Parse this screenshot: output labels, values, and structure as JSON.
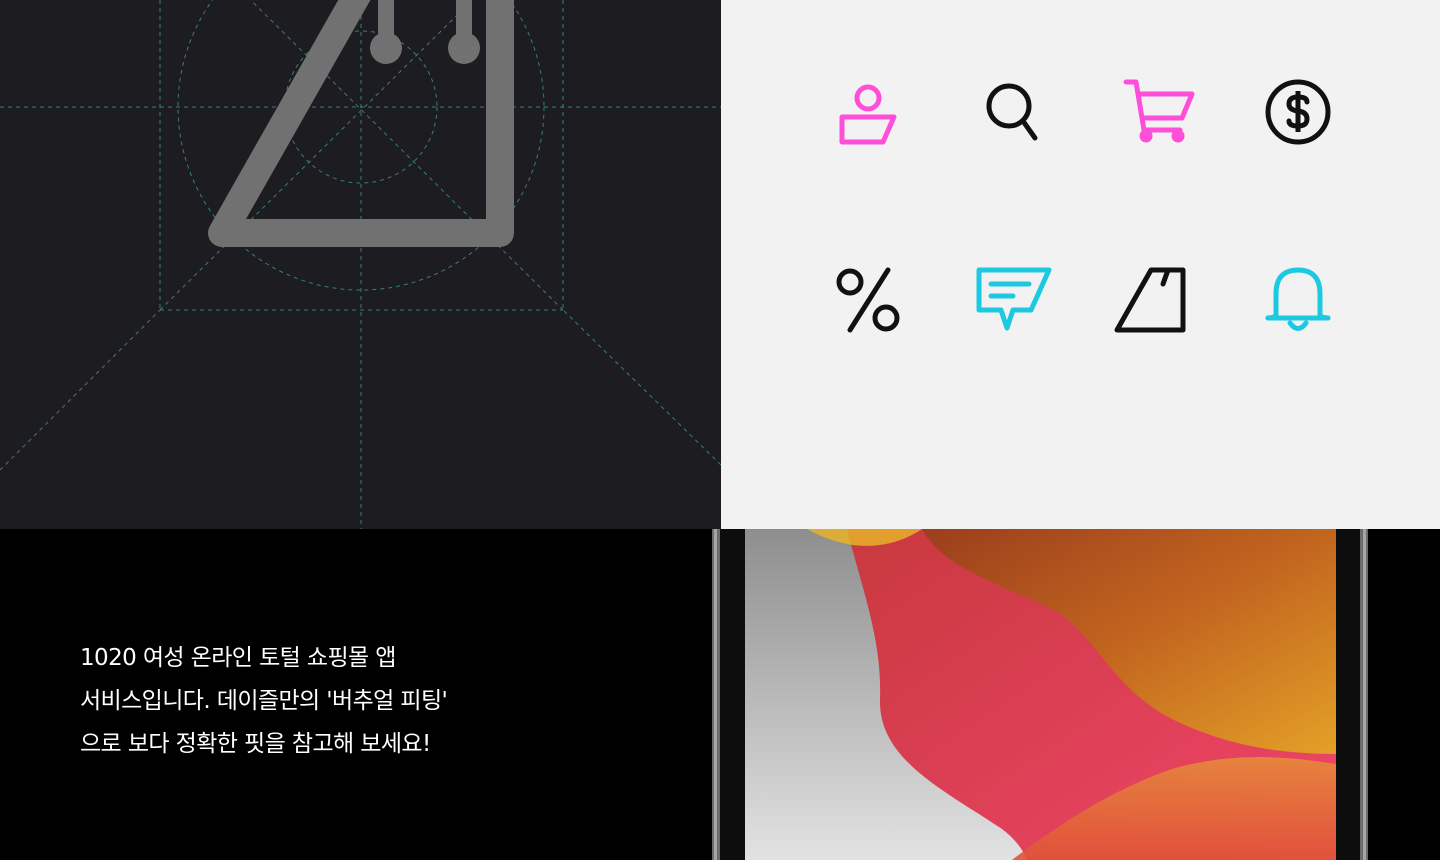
{
  "grid_panel": {
    "icon_name": "tag-icon",
    "background": "#1c1c21",
    "guide_color": "#3fa0a0",
    "icon_color": "#717171"
  },
  "icon_panel": {
    "background": "#f2f2f2",
    "colors": {
      "pink": "#ff4fd8",
      "cyan": "#1cc9e0",
      "black": "#111111"
    },
    "icons": [
      {
        "name": "user-icon",
        "color": "pink"
      },
      {
        "name": "search-icon",
        "color": "black"
      },
      {
        "name": "cart-icon",
        "color": "pink"
      },
      {
        "name": "dollar-coin-icon",
        "color": "black"
      },
      {
        "name": "percent-icon",
        "color": "black"
      },
      {
        "name": "chat-icon",
        "color": "cyan"
      },
      {
        "name": "tag-icon",
        "color": "black"
      },
      {
        "name": "bell-icon",
        "color": "cyan"
      }
    ]
  },
  "description": {
    "lines": [
      "1020 여성 온라인 토털 쇼핑몰 앱",
      "서비스입니다. 데이즐만의 '버추얼 피팅'",
      "으로 보다 정확한 핏을 참고해 보세요!"
    ]
  },
  "device": {
    "name": "tablet-device",
    "wallpaper_colors": [
      "#9a9a9a",
      "#d9473f",
      "#e8a02b",
      "#e05a38"
    ]
  }
}
